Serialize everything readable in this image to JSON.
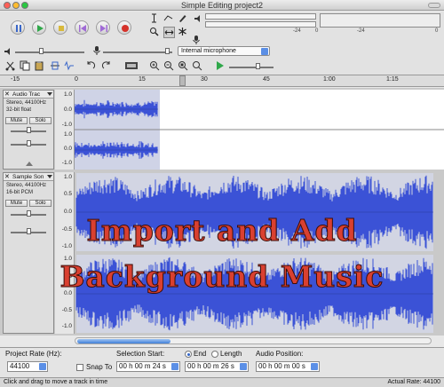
{
  "window": {
    "title": "Simple Editing project2"
  },
  "transport": {
    "buttons": [
      "pause",
      "play",
      "stop",
      "skip-to-start",
      "skip-to-end",
      "record"
    ]
  },
  "meters": {
    "play_ticks": [
      "-24",
      "0"
    ],
    "record_ticks": [
      "-24",
      "0"
    ]
  },
  "mixer": {
    "input_device": "Internal microphone"
  },
  "timeline": {
    "ticks": [
      "-15",
      "0",
      "15",
      "30",
      "45",
      "1:00",
      "1:15"
    ]
  },
  "tracks": [
    {
      "name": "Audio Trac",
      "info1": "Stereo, 44100Hz",
      "info2": "32-bit float",
      "mute": "Mute",
      "solo": "Solo",
      "scale": [
        "1.0",
        "0.0",
        "-1.0",
        "1.0",
        "0.0",
        "-1.0"
      ]
    },
    {
      "name": "Sample Son",
      "info1": "Stereo, 44100Hz",
      "info2": "16-bit PCM",
      "mute": "Mute",
      "solo": "Solo",
      "scale": [
        "1.0",
        "0.5",
        "0.0",
        "-0.5",
        "-1.0",
        "1.0",
        "0.5",
        "0.0",
        "-0.5",
        "-1.0"
      ]
    }
  ],
  "overlay": {
    "line1": "Import and Add",
    "line2": "Background Music"
  },
  "selection": {
    "project_rate_label": "Project Rate (Hz):",
    "project_rate": "44100",
    "snap_to": "Snap To",
    "selection_start_label": "Selection Start:",
    "start_value": "00 h 00 m 24 s",
    "end_label": "End",
    "length_label": "Length",
    "end_value": "00 h 00 m 26 s",
    "audio_position_label": "Audio Position:",
    "audio_position_value": "00 h 00 m 00 s"
  },
  "status": {
    "message": "Click and drag to move a track in time",
    "actual_rate": "Actual Rate: 44100"
  },
  "colors": {
    "wave": "#3b52d6",
    "overlay_text": "#d94030",
    "accent": "#5b8fe6"
  }
}
